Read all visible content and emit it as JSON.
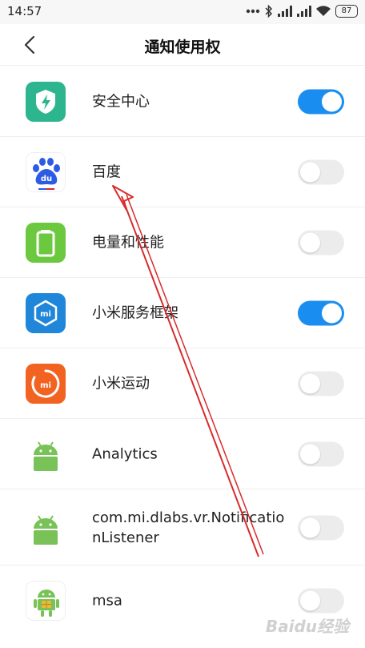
{
  "status_bar": {
    "time": "14:57",
    "battery": "87",
    "icons": [
      "dots-icon",
      "bluetooth-icon",
      "signal-icon",
      "signal-icon",
      "wifi-icon",
      "battery-icon"
    ]
  },
  "header": {
    "title": "通知使用权",
    "back_icon": "chevron-left-icon"
  },
  "apps": [
    {
      "name": "安全中心",
      "icon": "security-center-icon",
      "enabled": true
    },
    {
      "name": "百度",
      "icon": "baidu-icon",
      "enabled": false
    },
    {
      "name": "电量和性能",
      "icon": "battery-performance-icon",
      "enabled": false
    },
    {
      "name": "小米服务框架",
      "icon": "mi-service-framework-icon",
      "enabled": true
    },
    {
      "name": "小米运动",
      "icon": "mi-fit-icon",
      "enabled": false
    },
    {
      "name": "Analytics",
      "icon": "android-icon",
      "enabled": false
    },
    {
      "name": "com.mi.dlabs.vr.NotificationListener",
      "icon": "android-icon",
      "enabled": false
    },
    {
      "name": "msa",
      "icon": "msa-android-icon",
      "enabled": false
    }
  ],
  "colors": {
    "toggle_on": "#1a8ef0",
    "toggle_off": "#ececec",
    "annotation_arrow": "#d92b2b"
  },
  "watermark": "Baidu经验"
}
